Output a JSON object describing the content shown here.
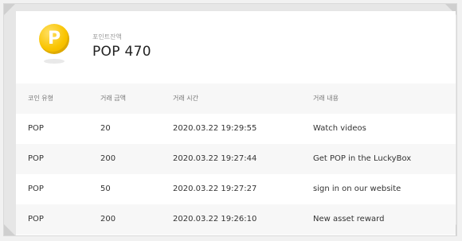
{
  "point": {
    "coin_letter": "P",
    "label": "포인트잔액",
    "value": "POP 470"
  },
  "table": {
    "headers": [
      "코인 유형",
      "거래 금액",
      "거래 시간",
      "거래 내용"
    ],
    "rows": [
      [
        "POP",
        "20",
        "2020.03.22 19:29:55",
        "Watch videos"
      ],
      [
        "POP",
        "200",
        "2020.03.22 19:27:44",
        "Get POP in the LuckyBox"
      ],
      [
        "POP",
        "50",
        "2020.03.22 19:27:27",
        "sign in on our website"
      ],
      [
        "POP",
        "200",
        "2020.03.22 19:26:10",
        "New asset reward"
      ]
    ]
  },
  "colors": {
    "coin": "#f9c400",
    "row_alt": "#f7f7f7",
    "frame": "#e6e6e6"
  }
}
